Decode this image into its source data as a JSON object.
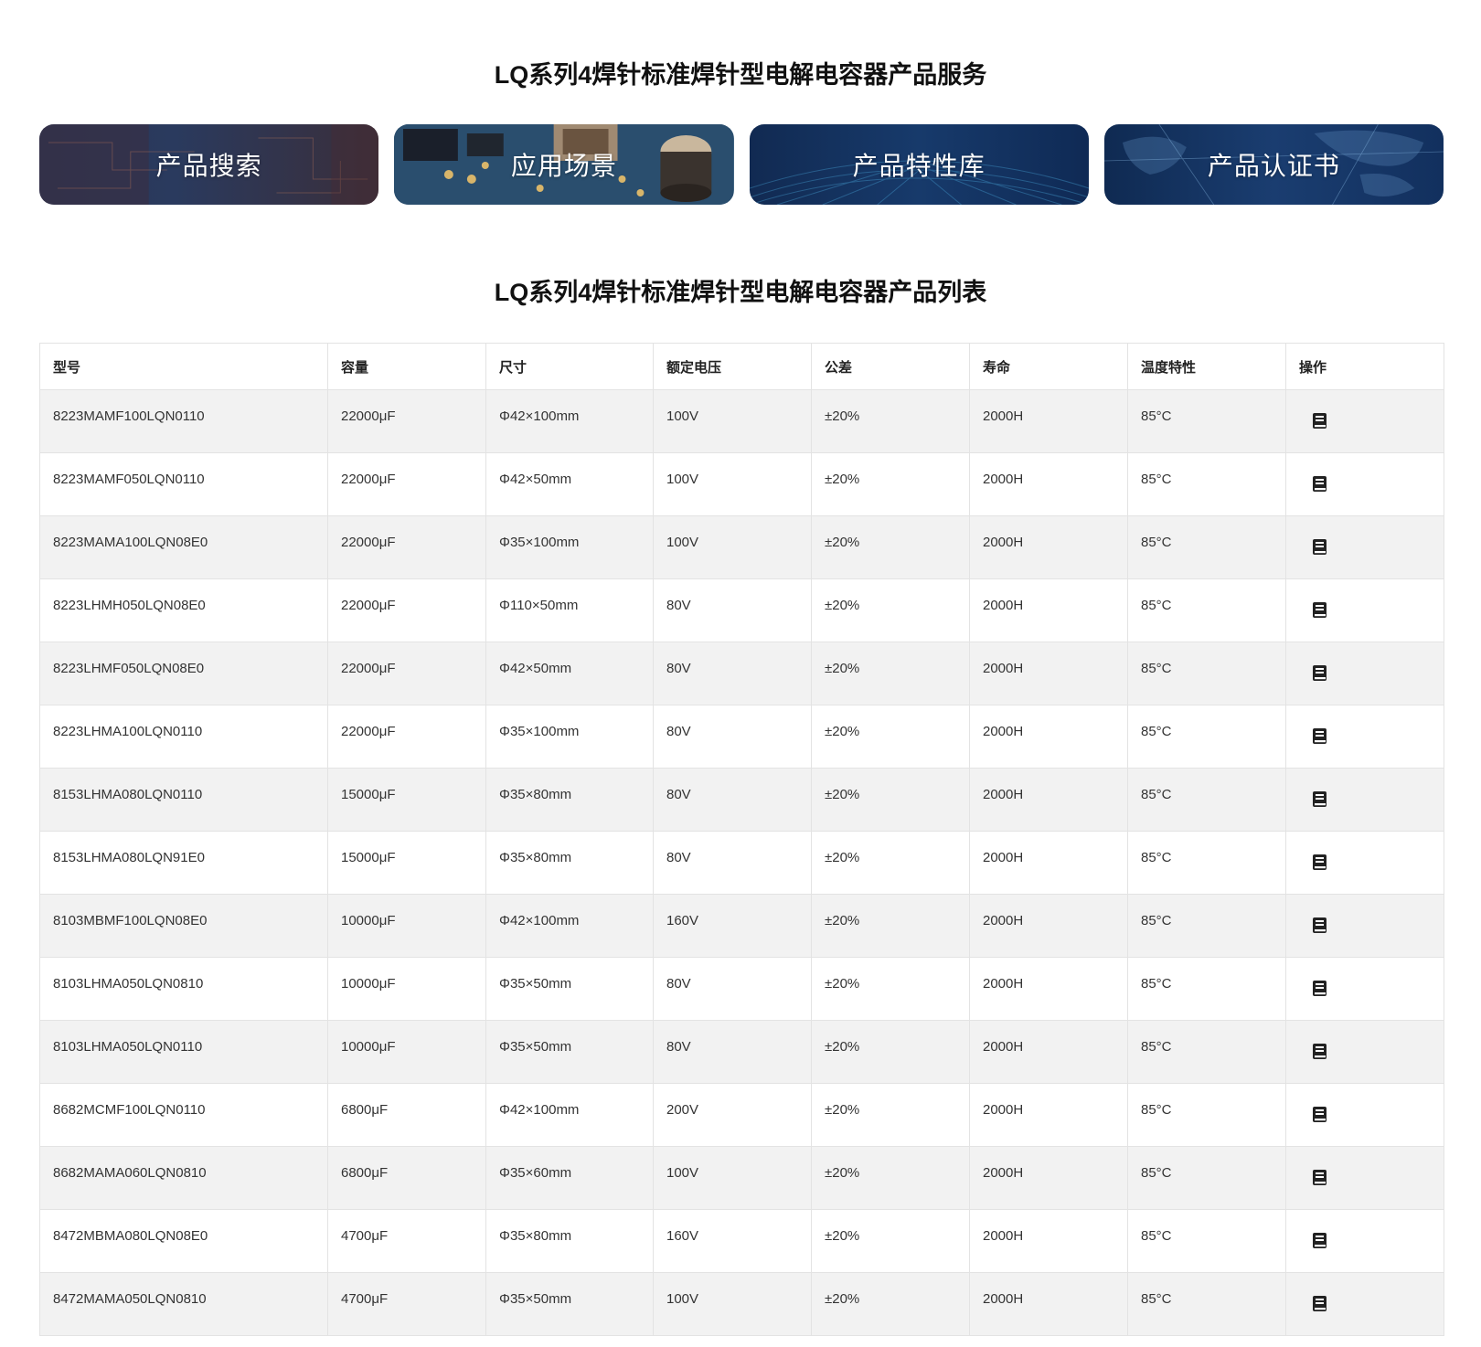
{
  "service_title": "LQ系列4焊针标准焊针型电解电容器产品服务",
  "list_title": "LQ系列4焊针标准焊针型电解电容器产品列表",
  "cards": [
    {
      "label": "产品搜索"
    },
    {
      "label": "应用场景"
    },
    {
      "label": "产品特性库"
    },
    {
      "label": "产品认证书"
    }
  ],
  "table": {
    "headers": [
      "型号",
      "容量",
      "尺寸",
      "额定电压",
      "公差",
      "寿命",
      "温度特性",
      "操作"
    ],
    "rows": [
      [
        "8223MAMF100LQN0110",
        "22000μF",
        "Φ42×100mm",
        "100V",
        "±20%",
        "2000H",
        "85°C"
      ],
      [
        "8223MAMF050LQN0110",
        "22000μF",
        "Φ42×50mm",
        "100V",
        "±20%",
        "2000H",
        "85°C"
      ],
      [
        "8223MAMA100LQN08E0",
        "22000μF",
        "Φ35×100mm",
        "100V",
        "±20%",
        "2000H",
        "85°C"
      ],
      [
        "8223LHMH050LQN08E0",
        "22000μF",
        "Φ110×50mm",
        "80V",
        "±20%",
        "2000H",
        "85°C"
      ],
      [
        "8223LHMF050LQN08E0",
        "22000μF",
        "Φ42×50mm",
        "80V",
        "±20%",
        "2000H",
        "85°C"
      ],
      [
        "8223LHMA100LQN0110",
        "22000μF",
        "Φ35×100mm",
        "80V",
        "±20%",
        "2000H",
        "85°C"
      ],
      [
        "8153LHMA080LQN0110",
        "15000μF",
        "Φ35×80mm",
        "80V",
        "±20%",
        "2000H",
        "85°C"
      ],
      [
        "8153LHMA080LQN91E0",
        "15000μF",
        "Φ35×80mm",
        "80V",
        "±20%",
        "2000H",
        "85°C"
      ],
      [
        "8103MBMF100LQN08E0",
        "10000μF",
        "Φ42×100mm",
        "160V",
        "±20%",
        "2000H",
        "85°C"
      ],
      [
        "8103LHMA050LQN0810",
        "10000μF",
        "Φ35×50mm",
        "80V",
        "±20%",
        "2000H",
        "85°C"
      ],
      [
        "8103LHMA050LQN0110",
        "10000μF",
        "Φ35×50mm",
        "80V",
        "±20%",
        "2000H",
        "85°C"
      ],
      [
        "8682MCMF100LQN0110",
        "6800μF",
        "Φ42×100mm",
        "200V",
        "±20%",
        "2000H",
        "85°C"
      ],
      [
        "8682MAMA060LQN0810",
        "6800μF",
        "Φ35×60mm",
        "100V",
        "±20%",
        "2000H",
        "85°C"
      ],
      [
        "8472MBMA080LQN08E0",
        "4700μF",
        "Φ35×80mm",
        "160V",
        "±20%",
        "2000H",
        "85°C"
      ],
      [
        "8472MAMA050LQN0810",
        "4700μF",
        "Φ35×50mm",
        "100V",
        "±20%",
        "2000H",
        "85°C"
      ]
    ],
    "action_icon": "book-icon"
  }
}
